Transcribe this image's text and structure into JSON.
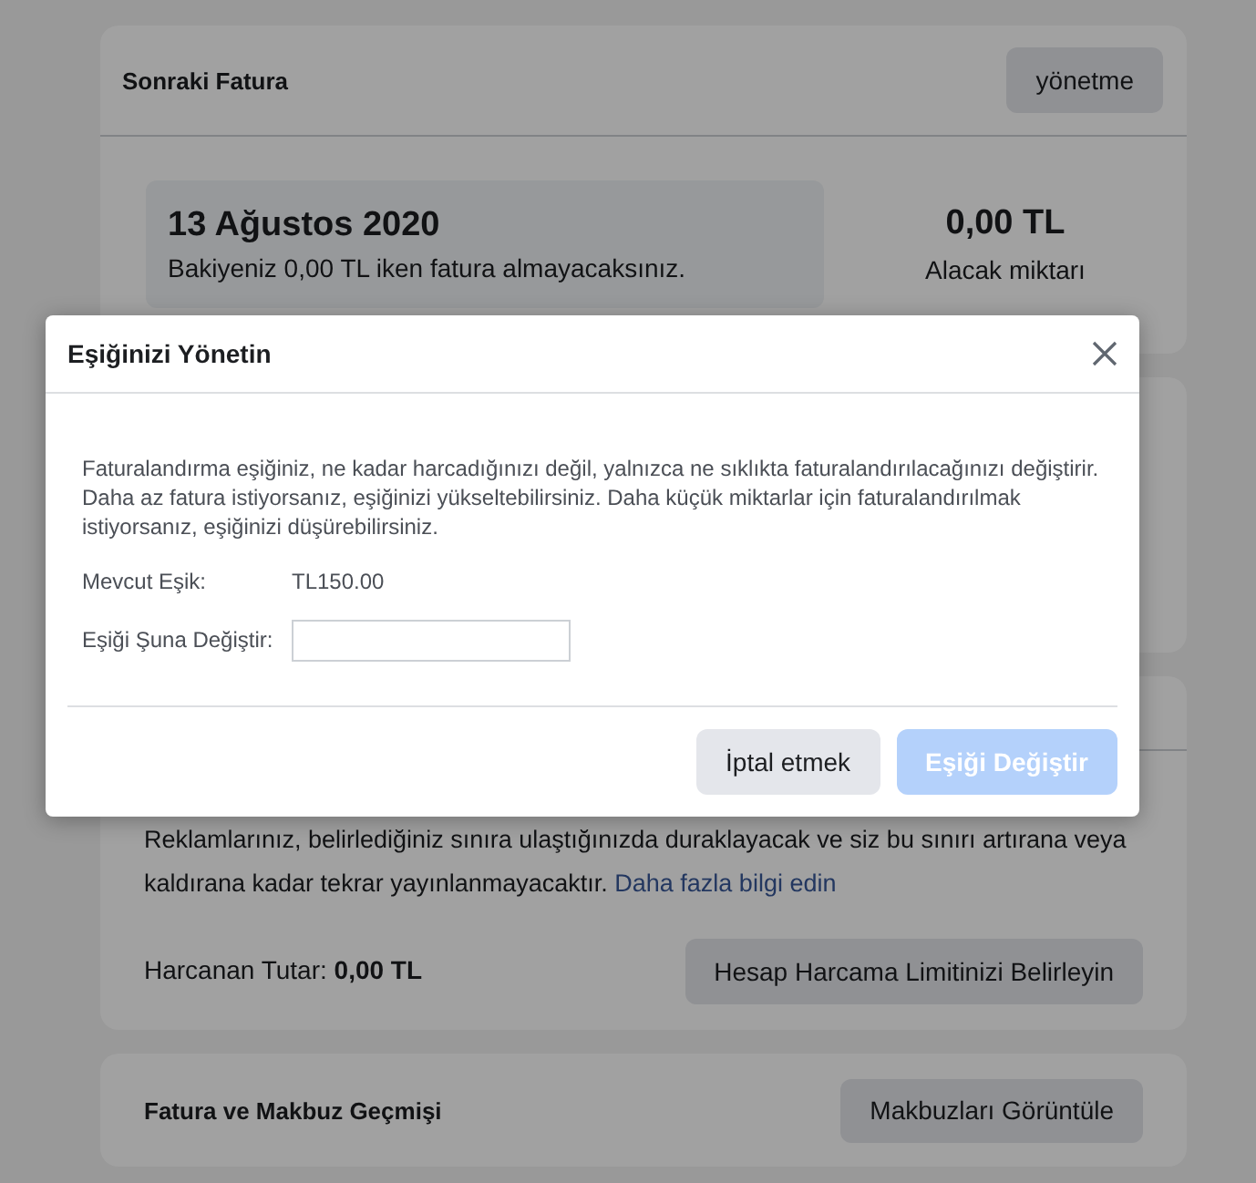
{
  "next_invoice": {
    "title": "Sonraki Fatura",
    "button": "yönetme",
    "date": "13 Ağustos 2020",
    "note": "Bakiyeniz 0,00 TL iken fatura almayacaksınız.",
    "amount": "0,00 TL",
    "amount_label": "Alacak miktarı"
  },
  "spending_limit": {
    "text": "Reklamlarınız, belirlediğiniz sınıra ulaştığınızda duraklayacak ve siz bu sınırı artırana veya kaldırana kadar tekrar yayınlanmayacaktır.",
    "link": "Daha fazla bilgi edin",
    "spent": "Harcanan Tutar: **0,00 TL**",
    "button": "Hesap Harcama Limitinizi Belirleyin"
  },
  "history": {
    "title": "Fatura ve Makbuz Geçmişi",
    "button": "Makbuzları Görüntüle"
  },
  "dialog": {
    "title": "Eşiğinizi Yönetin",
    "description": "Faturalandırma eşiğiniz, ne kadar harcadığınızı değil, yalnızca ne sıklıkta faturalandırılacağınızı değiştirir. Daha az fatura istiyorsanız, eşiğinizi yükseltebilirsiniz. Daha küçük miktarlar için faturalandırılmak istiyorsanız, eşiğinizi düşürebilirsiniz.",
    "current_label": "Mevcut Eşik:",
    "current_value": "TL150.00",
    "change_label": "Eşiği Şuna Değiştir:",
    "cancel": "İptal etmek",
    "submit": {
      "label": "Eşiği Değiştir",
      "disabled": true
    }
  }
}
